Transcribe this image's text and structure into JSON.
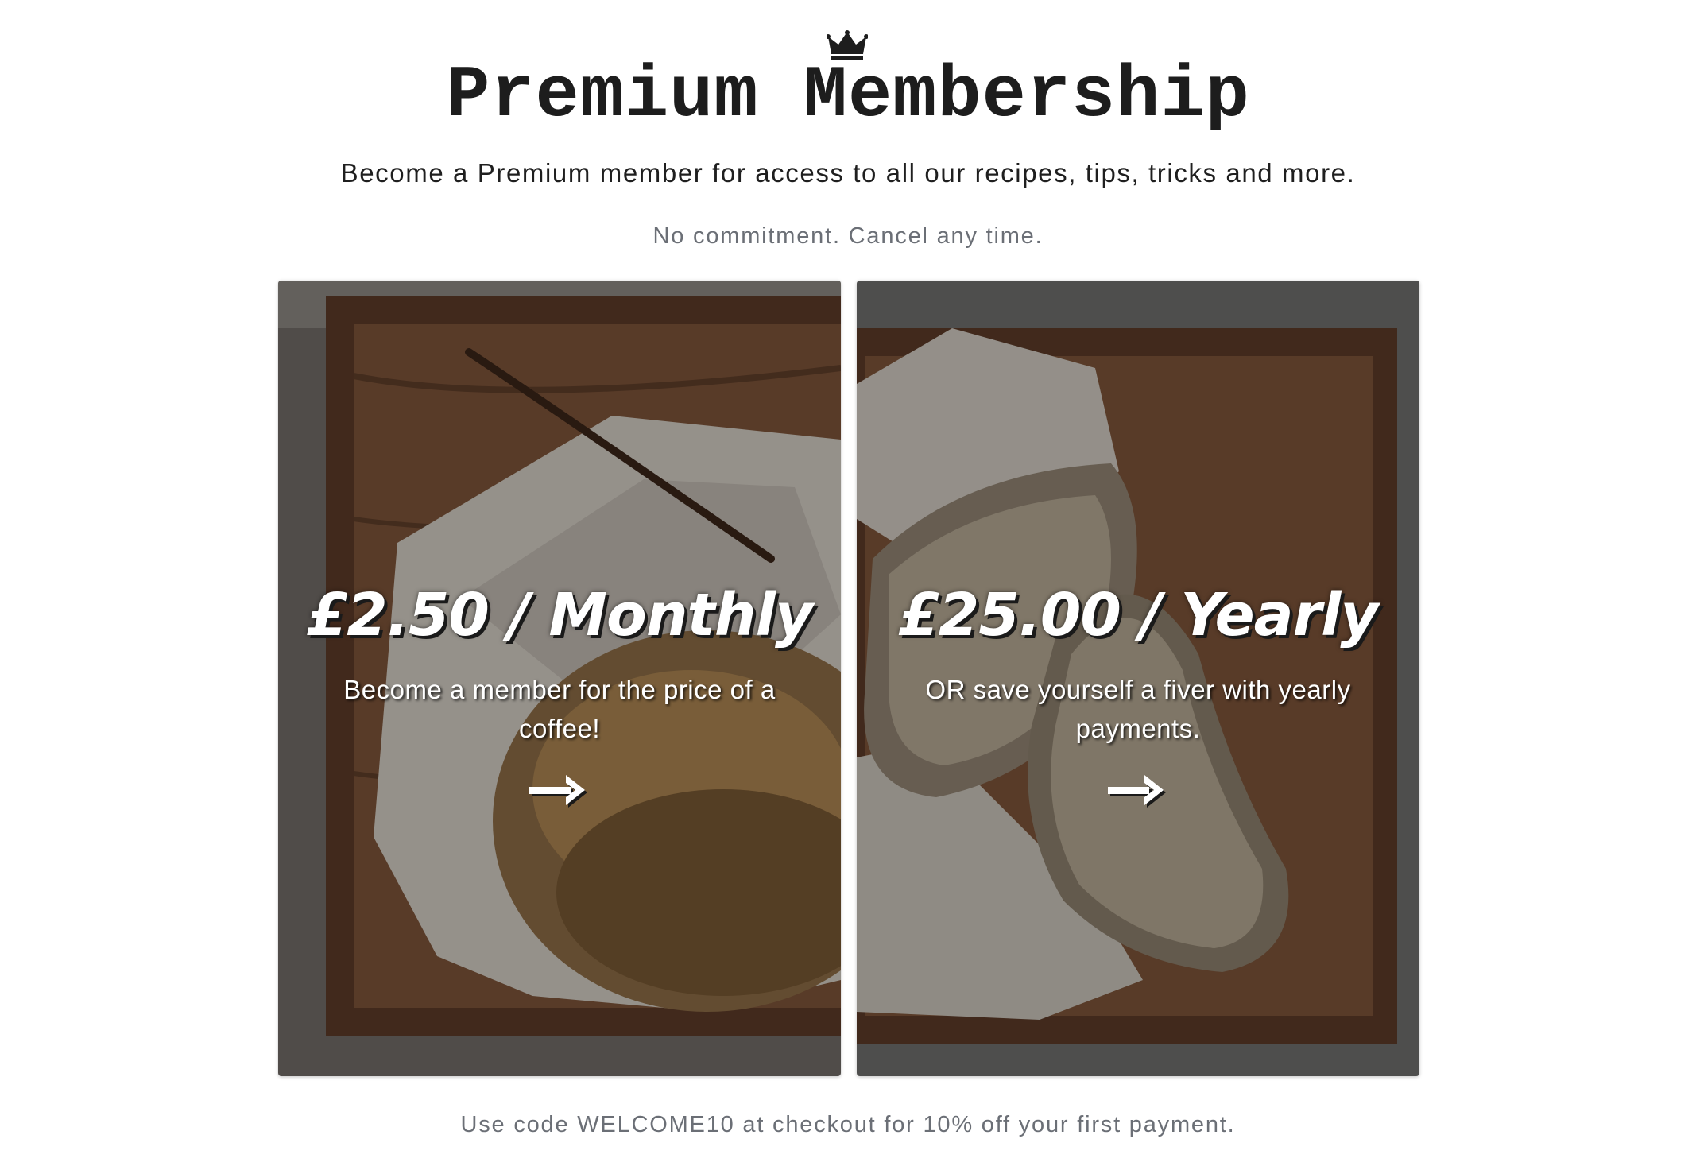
{
  "header": {
    "icon": "crown-icon",
    "title": "Premium Membership",
    "subtitle": "Become a Premium member for access to all our recipes, tips, tricks and more.",
    "note": "No commitment. Cancel any time."
  },
  "plans": [
    {
      "price": "£2.50 / Monthly",
      "description": "Become a member for the price of a coffee!",
      "icon": "arrow-right-icon"
    },
    {
      "price": "£25.00 / Yearly",
      "description": "OR save yourself a fiver with yearly payments.",
      "icon": "arrow-right-icon"
    }
  ],
  "footer": {
    "promo": "Use code WELCOME10 at checkout for 10% off your first payment."
  }
}
